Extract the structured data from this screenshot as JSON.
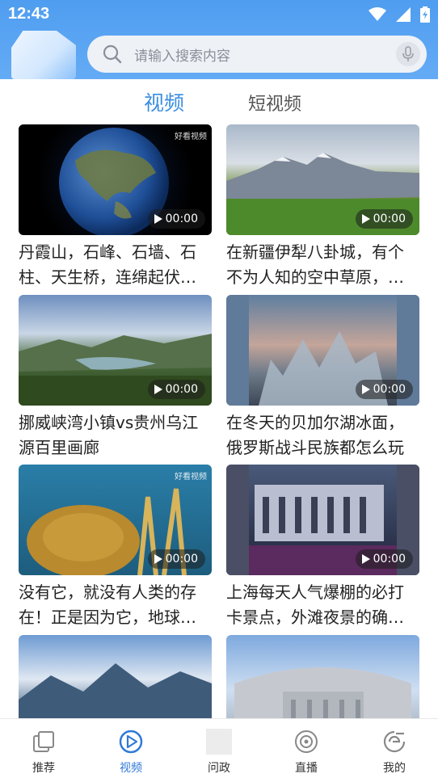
{
  "status": {
    "time": "12:43"
  },
  "search": {
    "placeholder": "请输入搜索内容"
  },
  "tabs": [
    {
      "label": "视频",
      "active": true
    },
    {
      "label": "短视频",
      "active": false
    }
  ],
  "videos": [
    {
      "title": "丹霞山，石峰、石墙、石柱、天生桥，连绵起伏的赤壁丹崖",
      "duration": "00:00",
      "watermark": "好看视频"
    },
    {
      "title": "在新疆伊犁八卦城，有个不为人知的空中草原，美如仙境",
      "duration": "00:00",
      "watermark": ""
    },
    {
      "title": "挪威峡湾小镇vs贵州乌江源百里画廊",
      "duration": "00:00",
      "watermark": ""
    },
    {
      "title": "在冬天的贝加尔湖冰面，俄罗斯战斗民族都怎么玩",
      "duration": "00:00",
      "watermark": ""
    },
    {
      "title": "没有它，就没有人类的存在！正是因为它，地球才有了生命",
      "duration": "00:00",
      "watermark": "好看视频"
    },
    {
      "title": "上海每天人气爆棚的必打卡景点，外滩夜景的确很美",
      "duration": "00:00",
      "watermark": ""
    },
    {
      "title": "",
      "duration": "",
      "watermark": ""
    },
    {
      "title": "",
      "duration": "",
      "watermark": ""
    }
  ],
  "nav": [
    {
      "label": "推荐",
      "icon": "recommend-icon"
    },
    {
      "label": "视频",
      "icon": "video-icon",
      "active": true
    },
    {
      "label": "问政",
      "icon": "inquiry-icon"
    },
    {
      "label": "直播",
      "icon": "live-icon"
    },
    {
      "label": "我的",
      "icon": "profile-icon"
    }
  ],
  "colors": {
    "accent": "#3b8ee0",
    "header": "#5aa4f3"
  }
}
